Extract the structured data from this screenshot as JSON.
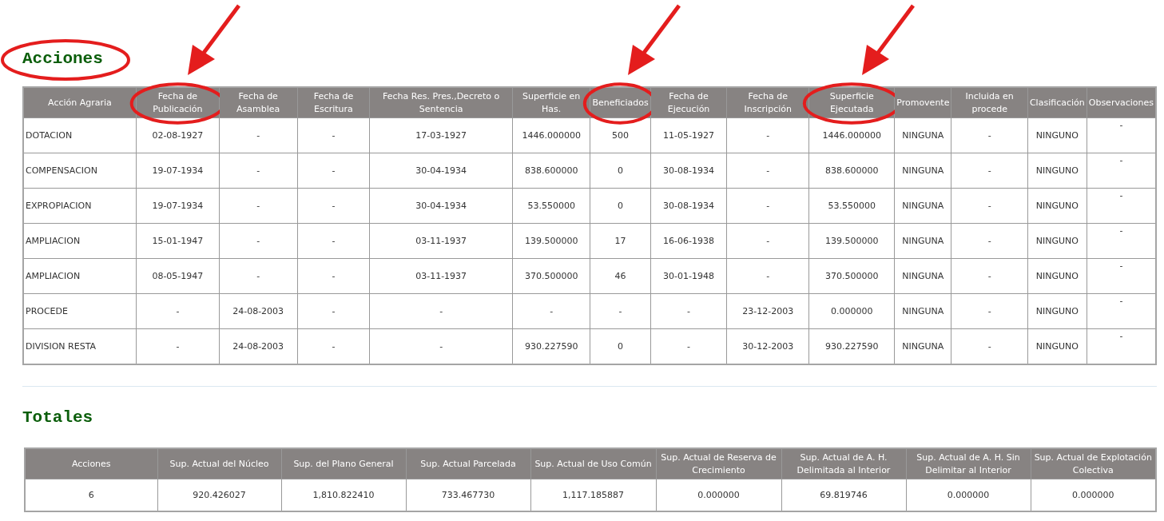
{
  "acciones": {
    "title": {
      "text": "Acciones",
      "circled": true
    },
    "columns": [
      {
        "label": "Acción Agraria",
        "circled": false
      },
      {
        "label": "Fecha de Publicación",
        "circled": true
      },
      {
        "label": "Fecha de Asamblea",
        "circled": false
      },
      {
        "label": "Fecha de Escritura",
        "circled": false
      },
      {
        "label": "Fecha Res. Pres.,Decreto o Sentencia",
        "circled": false
      },
      {
        "label": "Superficie en Has.",
        "circled": false
      },
      {
        "label": "Beneficiados",
        "circled": true
      },
      {
        "label": "Fecha de Ejecución",
        "circled": false
      },
      {
        "label": "Fecha de Inscripción",
        "circled": false
      },
      {
        "label": "Superficie Ejecutada",
        "circled": true
      },
      {
        "label": "Promovente",
        "circled": false
      },
      {
        "label": "Incluida en procede",
        "circled": false
      },
      {
        "label": "Clasificación",
        "circled": false
      },
      {
        "label": "Observaciones",
        "circled": false
      }
    ],
    "rows": [
      [
        "DOTACION",
        "02-08-1927",
        "-",
        "-",
        "17-03-1927",
        "1446.000000",
        "500",
        "11-05-1927",
        "-",
        "1446.000000",
        "NINGUNA",
        "-",
        "NINGUNO",
        "-"
      ],
      [
        "COMPENSACION",
        "19-07-1934",
        "-",
        "-",
        "30-04-1934",
        "838.600000",
        "0",
        "30-08-1934",
        "-",
        "838.600000",
        "NINGUNA",
        "-",
        "NINGUNO",
        "-"
      ],
      [
        "EXPROPIACION",
        "19-07-1934",
        "-",
        "-",
        "30-04-1934",
        "53.550000",
        "0",
        "30-08-1934",
        "-",
        "53.550000",
        "NINGUNA",
        "-",
        "NINGUNO",
        "-"
      ],
      [
        "AMPLIACION",
        "15-01-1947",
        "-",
        "-",
        "03-11-1937",
        "139.500000",
        "17",
        "16-06-1938",
        "-",
        "139.500000",
        "NINGUNA",
        "-",
        "NINGUNO",
        "-"
      ],
      [
        "AMPLIACION",
        "08-05-1947",
        "-",
        "-",
        "03-11-1937",
        "370.500000",
        "46",
        "30-01-1948",
        "-",
        "370.500000",
        "NINGUNA",
        "-",
        "NINGUNO",
        "-"
      ],
      [
        "PROCEDE",
        "-",
        "24-08-2003",
        "-",
        "-",
        "-",
        "-",
        "-",
        "23-12-2003",
        "0.000000",
        "NINGUNA",
        "-",
        "NINGUNO",
        "-"
      ],
      [
        "DIVISION RESTA",
        "-",
        "24-08-2003",
        "-",
        "-",
        "930.227590",
        "0",
        "-",
        "30-12-2003",
        "930.227590",
        "NINGUNA",
        "-",
        "NINGUNO",
        "-"
      ]
    ]
  },
  "totales": {
    "title": {
      "text": "Totales",
      "circled": false
    },
    "columns": [
      {
        "label": "Acciones",
        "circled": false
      },
      {
        "label": "Sup. Actual del Núcleo",
        "circled": false
      },
      {
        "label": "Sup. del Plano General",
        "circled": false
      },
      {
        "label": "Sup. Actual Parcelada",
        "circled": false
      },
      {
        "label": "Sup. Actual de Uso Común",
        "circled": false
      },
      {
        "label": "Sup. Actual de Reserva de Crecimiento",
        "circled": false
      },
      {
        "label": "Sup. Actual de A. H. Delimitada al Interior",
        "circled": false
      },
      {
        "label": "Sup. Actual de A. H. Sin Delimitar al Interior",
        "circled": false
      },
      {
        "label": "Sup. Actual de Explotación Colectiva",
        "circled": false
      }
    ],
    "rows": [
      [
        "6",
        "920.426027",
        "1,810.822410",
        "733.467730",
        "1,117.185887",
        "0.000000",
        "69.819746",
        "0.000000",
        "0.000000"
      ]
    ]
  }
}
